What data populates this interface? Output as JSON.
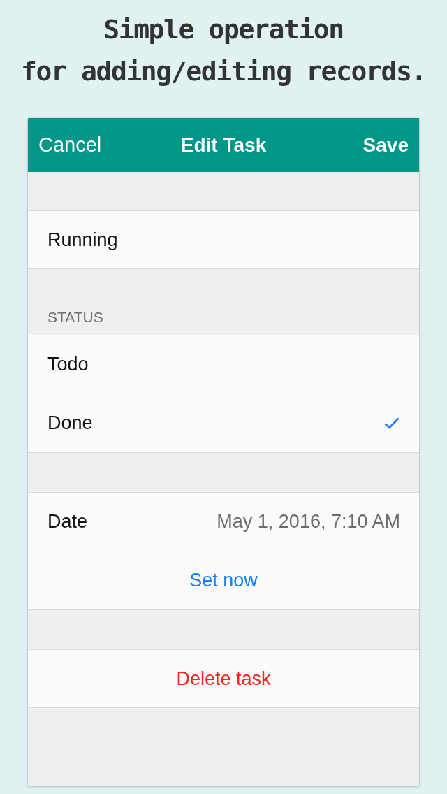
{
  "headline": {
    "lines": [
      "Simple operation",
      "for adding/editing records."
    ]
  },
  "nav_bar": {
    "cancel": "Cancel",
    "title": "Edit Task",
    "save": "Save"
  },
  "name_field": {
    "value": "Running"
  },
  "status_section": {
    "header": "STATUS",
    "options": [
      {
        "label": "Todo",
        "selected": false
      },
      {
        "label": "Done",
        "selected": true
      }
    ]
  },
  "date_section": {
    "label": "Date",
    "value": "May 1, 2016, 7:10 AM",
    "set_now": "Set now"
  },
  "delete_button": {
    "label": "Delete task"
  }
}
